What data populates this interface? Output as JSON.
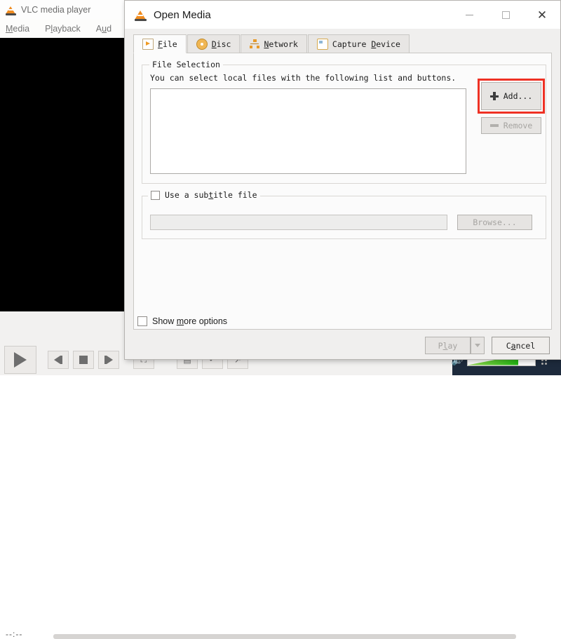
{
  "vlc": {
    "title": "VLC media player",
    "app_icon": "vlc-cone-icon",
    "menu": [
      {
        "label_before": "",
        "mnemonic": "M",
        "label_after": "edia"
      },
      {
        "label_before": "P",
        "mnemonic": "l",
        "label_after": "ayback"
      },
      {
        "label_before": "A",
        "mnemonic": "u",
        "label_after": "d"
      }
    ],
    "menu_plain": [
      "Media",
      "Playback",
      "Aud"
    ],
    "time_elapsed": "--:--",
    "controls": {
      "play": "play-icon",
      "previous": "previous-track-icon",
      "stop": "stop-icon",
      "next": "next-track-icon",
      "fullscreen": "fullscreen-icon",
      "extended_settings": "extended-settings-icon",
      "loop": "loop-icon",
      "random": "random-icon"
    },
    "volume": {
      "icon": "speaker-icon",
      "fill_percent": 74,
      "fill_color": "#22b512"
    }
  },
  "dialog": {
    "title": "Open Media",
    "icon": "vlc-cone-icon",
    "window_controls": {
      "minimize": "minimize-icon",
      "maximize": "maximize-icon",
      "close": "close-icon"
    },
    "tabs": [
      {
        "id": "file",
        "icon": "file-icon",
        "pre": "",
        "mnemonic": "F",
        "post": "ile",
        "active": true
      },
      {
        "id": "disc",
        "icon": "disc-icon",
        "pre": "",
        "mnemonic": "D",
        "post": "isc",
        "active": false
      },
      {
        "id": "network",
        "icon": "network-icon",
        "pre": "",
        "mnemonic": "N",
        "post": "etwork",
        "active": false
      },
      {
        "id": "capture",
        "icon": "capture-device-icon",
        "pre": "Capture ",
        "mnemonic": "D",
        "post": "evice",
        "active": false
      }
    ],
    "file_selection": {
      "group_label": "File Selection",
      "hint": "You can select local files with the following list and buttons.",
      "list_items": [],
      "add_button": "Add...",
      "add_icon": "plus-icon",
      "add_highlight_color": "#ee3124",
      "remove_button": "Remove",
      "remove_icon": "minus-icon",
      "remove_disabled": true
    },
    "subtitle": {
      "checkbox_pre": "Use a sub",
      "checkbox_mnemonic": "t",
      "checkbox_post": "itle file",
      "checkbox_label": "Use a subtitle file",
      "checked": false,
      "path_value": "",
      "path_placeholder": "",
      "browse_button": "Browse...",
      "browse_disabled": true
    },
    "footer": {
      "show_more_pre": "Show ",
      "show_more_mnemonic": "m",
      "show_more_post": "ore options",
      "show_more_label": "Show more options",
      "show_more_checked": false,
      "play_pre": "P",
      "play_mnemonic": "l",
      "play_post": "ay",
      "play_button": "Play",
      "play_disabled": true,
      "play_dropdown_icon": "chevron-down-icon",
      "cancel_pre": "C",
      "cancel_mnemonic": "a",
      "cancel_post": "ncel",
      "cancel_button": "Cancel"
    }
  }
}
